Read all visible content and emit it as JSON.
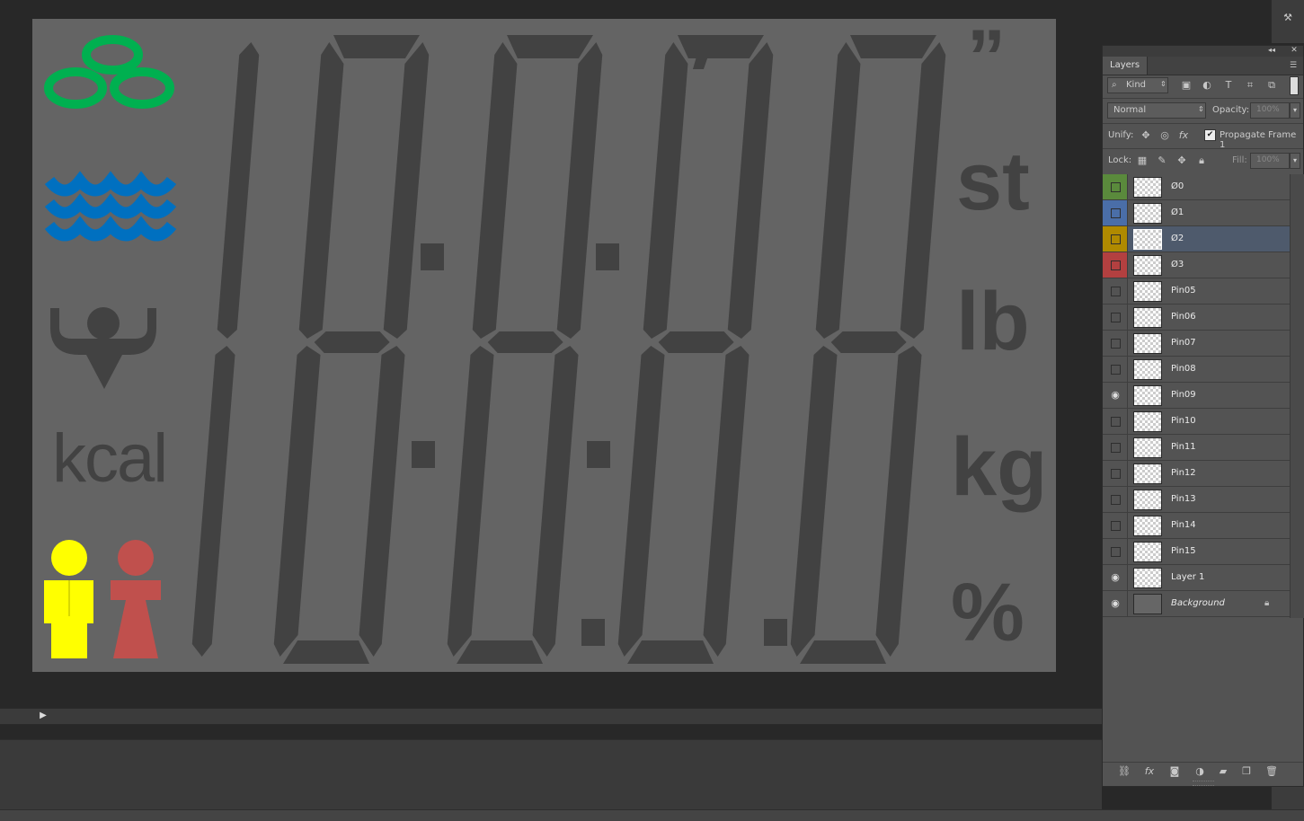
{
  "canvas": {
    "kcal_label": "kcal",
    "units": [
      "”",
      "st",
      "lb",
      "kg",
      "%"
    ],
    "colors": {
      "background": "#646464",
      "segment": "#424242",
      "green_rings": "#00b050",
      "blue_waves": "#0070c0",
      "yellow_person": "#ffff00",
      "red_person": "#c0504d"
    }
  },
  "timeline": {
    "play_icon": "▶"
  },
  "layers_panel": {
    "tab_title": "Layers",
    "filter": {
      "kind_label": "Kind",
      "search_icon": "⌕"
    },
    "blend_mode": "Normal",
    "opacity_label": "Opacity:",
    "opacity_value": "100%",
    "unify_label": "Unify:",
    "propagate_checked": "✔",
    "propagate_label": "Propagate Frame 1",
    "lock_label": "Lock:",
    "fill_label": "Fill:",
    "fill_value": "100%",
    "layers": [
      {
        "name": "Ø0",
        "color": "#5a8a3c",
        "visible": false
      },
      {
        "name": "Ø1",
        "color": "#4a6ea8",
        "visible": false
      },
      {
        "name": "Ø2",
        "color": "#b08a00",
        "visible": false,
        "selected": true
      },
      {
        "name": "Ø3",
        "color": "#b34040",
        "visible": false
      },
      {
        "name": "Pin05",
        "visible": false
      },
      {
        "name": "Pin06",
        "visible": false
      },
      {
        "name": "Pin07",
        "visible": false
      },
      {
        "name": "Pin08",
        "visible": false
      },
      {
        "name": "Pin09",
        "visible": true
      },
      {
        "name": "Pin10",
        "visible": false
      },
      {
        "name": "Pin11",
        "visible": false
      },
      {
        "name": "Pin12",
        "visible": false
      },
      {
        "name": "Pin13",
        "visible": false
      },
      {
        "name": "Pin14",
        "visible": false
      },
      {
        "name": "Pin15",
        "visible": false
      },
      {
        "name": "Layer 1",
        "visible": true
      },
      {
        "name": "Background",
        "visible": true,
        "locked": true
      }
    ]
  }
}
